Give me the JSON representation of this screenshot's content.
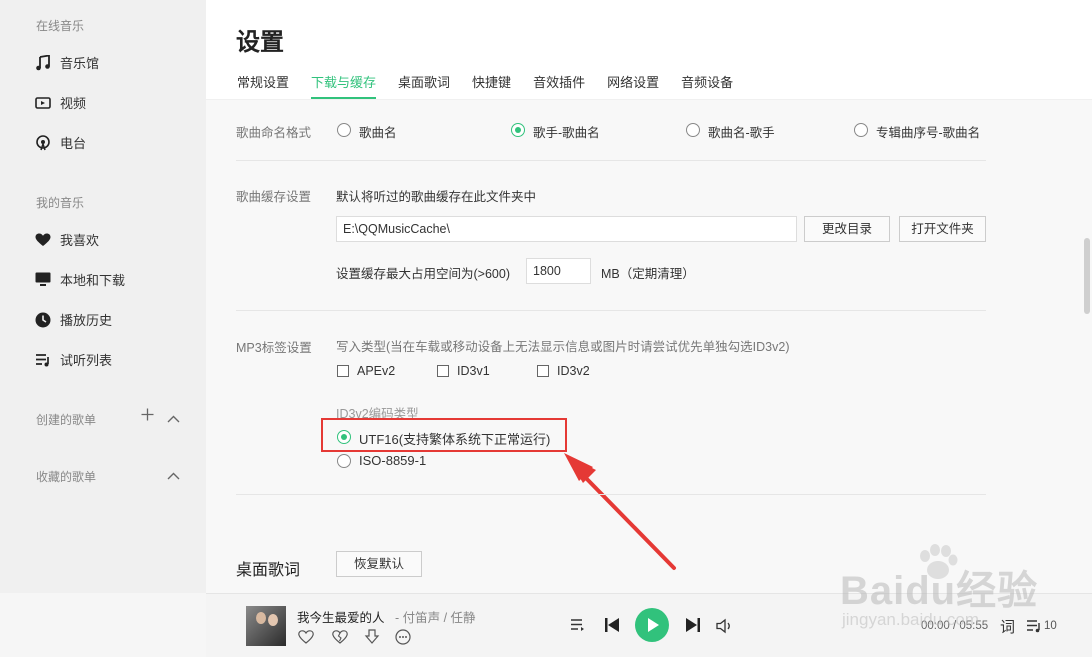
{
  "sidebar": {
    "online_title": "在线音乐",
    "online_items": [
      {
        "label": "音乐馆",
        "icon": "music-note-icon"
      },
      {
        "label": "视频",
        "icon": "video-icon"
      },
      {
        "label": "电台",
        "icon": "radio-icon"
      }
    ],
    "my_title": "我的音乐",
    "my_items": [
      {
        "label": "我喜欢",
        "icon": "heart-icon"
      },
      {
        "label": "本地和下载",
        "icon": "monitor-icon"
      },
      {
        "label": "播放历史",
        "icon": "clock-icon"
      },
      {
        "label": "试听列表",
        "icon": "playlist-icon"
      }
    ],
    "created_title": "创建的歌单",
    "collected_title": "收藏的歌单"
  },
  "header": {
    "title": "设置",
    "tabs": [
      {
        "label": "常规设置",
        "active": false
      },
      {
        "label": "下载与缓存",
        "active": true
      },
      {
        "label": "桌面歌词",
        "active": false
      },
      {
        "label": "快捷键",
        "active": false
      },
      {
        "label": "音效插件",
        "active": false
      },
      {
        "label": "网络设置",
        "active": false
      },
      {
        "label": "音频设备",
        "active": false
      }
    ]
  },
  "naming": {
    "label": "歌曲命名格式",
    "options": [
      {
        "label": "歌曲名",
        "selected": false
      },
      {
        "label": "歌手-歌曲名",
        "selected": true
      },
      {
        "label": "歌曲名-歌手",
        "selected": false
      },
      {
        "label": "专辑曲序号-歌曲名",
        "selected": false
      }
    ]
  },
  "cache": {
    "label": "歌曲缓存设置",
    "description": "默认将听过的歌曲缓存在此文件夹中",
    "path": "E:\\QQMusicCache\\",
    "change_dir_button": "更改目录",
    "open_folder_button": "打开文件夹",
    "max_space_label": "设置缓存最大占用空间为(>600)",
    "max_space_value": "1800",
    "max_space_unit": "MB（定期清理）"
  },
  "mp3tag": {
    "label": "MP3标签设置",
    "write_type_hint": "写入类型(当在车载或移动设备上无法显示信息或图片时请尝试优先单独勾选ID3v2)",
    "checkboxes": [
      {
        "label": "APEv2",
        "checked": false
      },
      {
        "label": "ID3v1",
        "checked": false
      },
      {
        "label": "ID3v2",
        "checked": false
      }
    ],
    "encoding_title": "ID3v2编码类型",
    "encodings": [
      {
        "label": "UTF16(支持繁体系统下正常运行)",
        "selected": true
      },
      {
        "label": "ISO-8859-1",
        "selected": false
      }
    ]
  },
  "lyrics": {
    "section_title": "桌面歌词",
    "reset_button": "恢复默认"
  },
  "player": {
    "song_title": "我今生最爱的人",
    "artist": " - 付笛声 / 任静",
    "time": "00:00 / 05:55",
    "lyrics_toggle": "词",
    "queue_count": "10"
  },
  "watermark": {
    "brand": "Baidu经验",
    "url": "jingyan.baidu.com"
  },
  "colors": {
    "accent": "#31c27c",
    "highlight": "#e53935"
  }
}
